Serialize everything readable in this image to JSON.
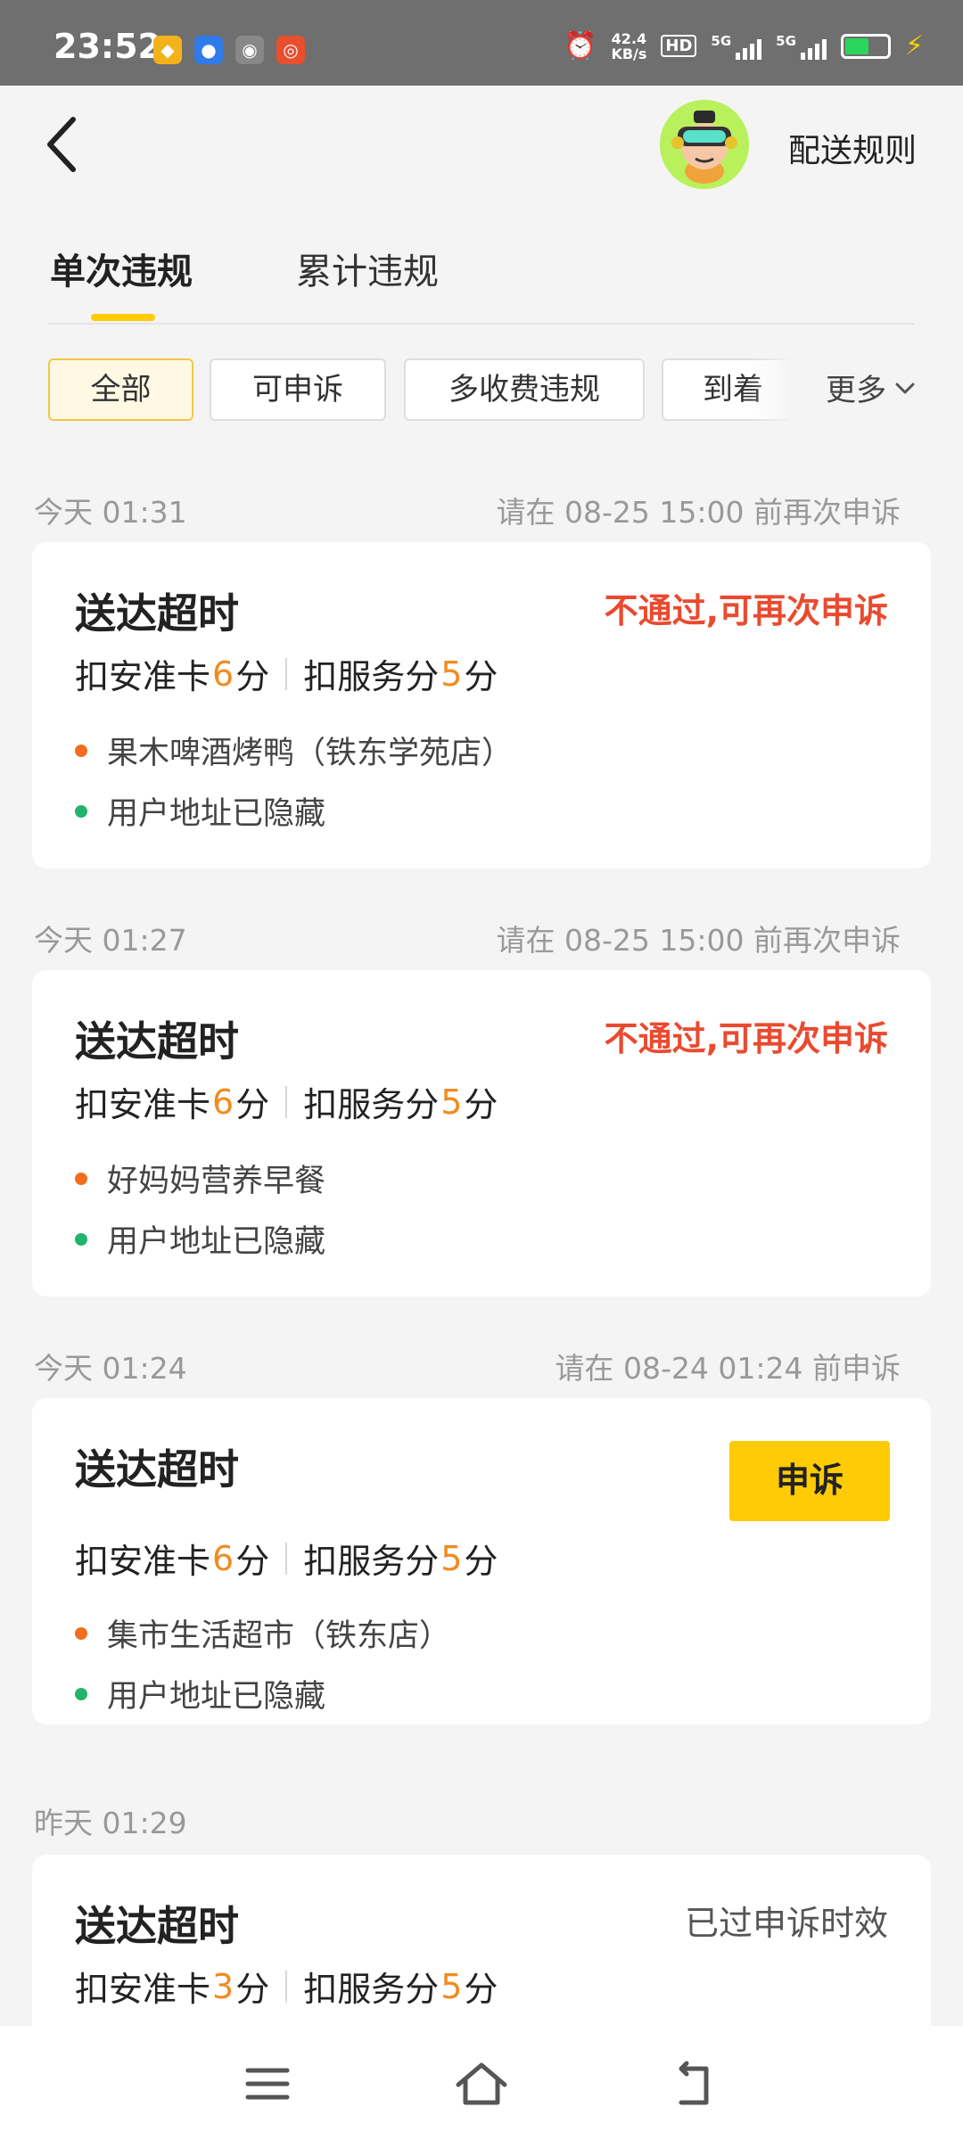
{
  "status_bar": {
    "time": "23:52",
    "speed_value": "42.4",
    "speed_unit": "KB/s",
    "hd_label": "HD",
    "net1": "5G",
    "net2": "5G",
    "icons": [
      "app-icon-yellow",
      "baidu-icon",
      "wechat-icon",
      "weibo-icon",
      "alarm-icon",
      "battery-icon",
      "charging-icon"
    ]
  },
  "header": {
    "back_icon": "chevron-left-icon",
    "rules_link": "配送规则"
  },
  "tabs": [
    {
      "label": "单次违规",
      "active": true
    },
    {
      "label": "累计违规",
      "active": false
    }
  ],
  "filters": {
    "chips": [
      "全部",
      "可申诉",
      "多收费违规",
      "到着"
    ],
    "more": "更多",
    "accent": "#ffcb05"
  },
  "records": [
    {
      "time": "今天 01:31",
      "deadline": "请在 08-25 15:00 前再次申诉",
      "title": "送达超时",
      "status": "不通过,可再次申诉",
      "penalty": {
        "label1": "扣安准卡",
        "num1": "6",
        "unit1": "分",
        "label2": "扣服务分",
        "num2": "5",
        "unit2": "分"
      },
      "store": "果木啤酒烤鸭（铁东学苑店）",
      "address": "用户地址已隐藏"
    },
    {
      "time": "今天 01:27",
      "deadline": "请在 08-25 15:00 前再次申诉",
      "title": "送达超时",
      "status": "不通过,可再次申诉",
      "penalty": {
        "label1": "扣安准卡",
        "num1": "6",
        "unit1": "分",
        "label2": "扣服务分",
        "num2": "5",
        "unit2": "分"
      },
      "store": "好妈妈营养早餐",
      "address": "用户地址已隐藏"
    },
    {
      "time": "今天 01:24",
      "deadline": "请在 08-24 01:24 前申诉",
      "title": "送达超时",
      "button": "申诉",
      "penalty": {
        "label1": "扣安准卡",
        "num1": "6",
        "unit1": "分",
        "label2": "扣服务分",
        "num2": "5",
        "unit2": "分"
      },
      "store": "集市生活超市（铁东店）",
      "address": "用户地址已隐藏"
    },
    {
      "time": "昨天 01:29",
      "title": "送达超时",
      "status": "已过申诉时效",
      "penalty": {
        "label1": "扣安准卡",
        "num1": "3",
        "unit1": "分",
        "label2": "扣服务分",
        "num2": "5",
        "unit2": "分"
      }
    }
  ],
  "colors": {
    "reject_red": "#ea4a2f",
    "number_orange": "#f28b1e",
    "store_dot": "#f36d1e",
    "address_dot": "#23b46b"
  },
  "nav": {
    "icons": [
      "menu-icon",
      "home-icon",
      "back-icon"
    ]
  }
}
